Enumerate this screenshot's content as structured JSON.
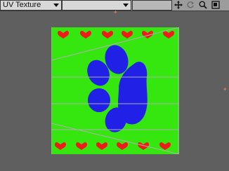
{
  "toolbar": {
    "dropdown_label": "UV Texture",
    "tools": [
      "move-icon",
      "rotate-icon",
      "zoom-icon",
      "maximize-icon"
    ]
  },
  "colors": {
    "texture_background": "#35e60f",
    "paw": "#2020e6",
    "hearts": "#f01a1a",
    "uv_lines": "#b0b0b0",
    "viewport": "#5f5f5f"
  }
}
